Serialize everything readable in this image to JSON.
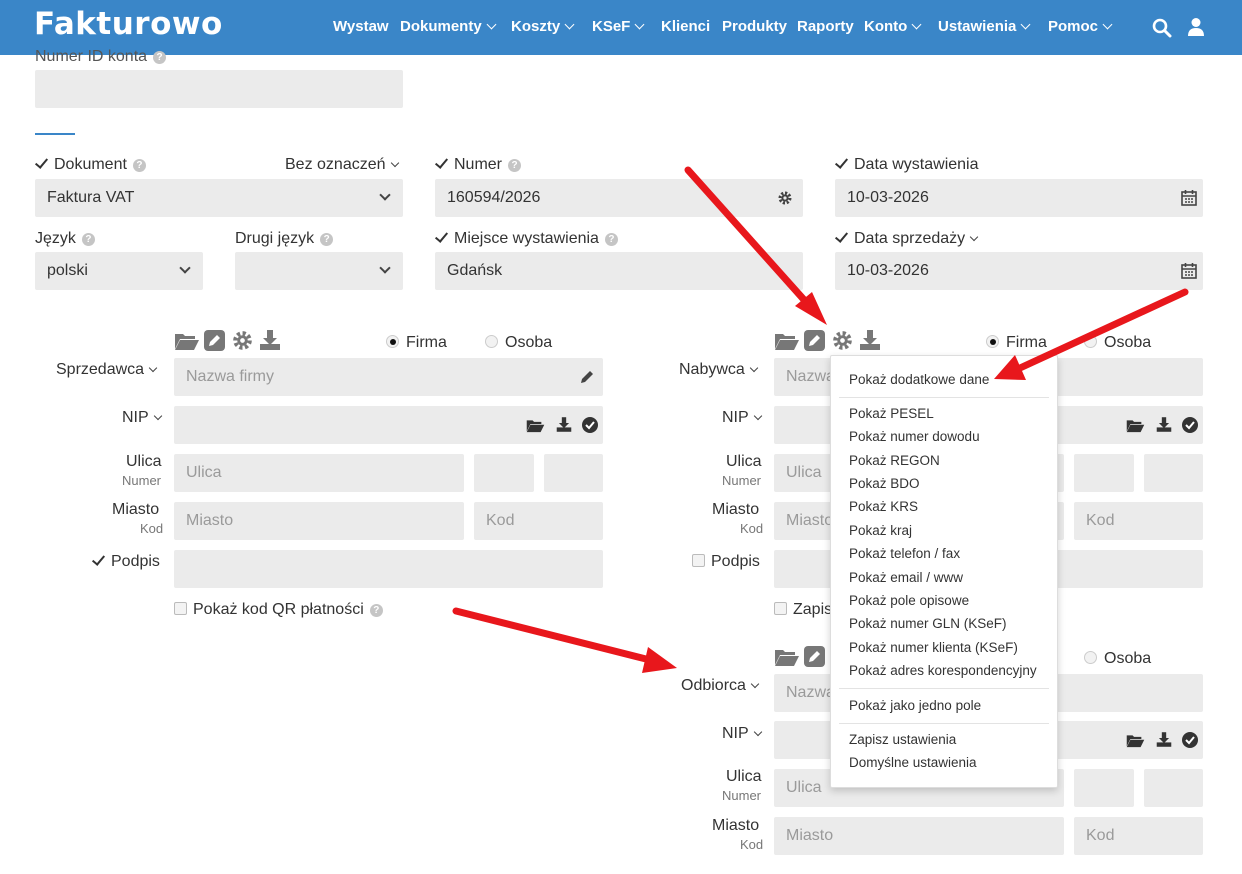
{
  "app": {
    "logo": "Fakturowo",
    "nav": [
      {
        "label": "Wystaw",
        "dropdown": false
      },
      {
        "label": "Dokumenty",
        "dropdown": true
      },
      {
        "label": "Koszty",
        "dropdown": true
      },
      {
        "label": "KSeF",
        "dropdown": true
      },
      {
        "label": "Klienci",
        "dropdown": false
      },
      {
        "label": "Produkty",
        "dropdown": false
      },
      {
        "label": "Raporty",
        "dropdown": false
      },
      {
        "label": "Konto",
        "dropdown": true
      },
      {
        "label": "Ustawienia",
        "dropdown": true
      },
      {
        "label": "Pomoc",
        "dropdown": true
      }
    ],
    "colors": {
      "navbar": "#3a86c8",
      "field_bg": "#ebebeb",
      "accent_line": "#3a86c8",
      "arrow": "#e8171c"
    }
  },
  "account": {
    "label": "Numer ID konta",
    "value": ""
  },
  "document": {
    "label": "Dokument",
    "marking": "Bez oznaczeń",
    "value": "Faktura VAT"
  },
  "number": {
    "label": "Numer",
    "value": "160594/2026"
  },
  "issue_date": {
    "label": "Data wystawienia",
    "value": "10-03-2026"
  },
  "language": {
    "label": "Język",
    "value": "polski"
  },
  "second_language": {
    "label": "Drugi język",
    "value": ""
  },
  "place": {
    "label": "Miejsce wystawienia",
    "value": "Gdańsk"
  },
  "sale_date": {
    "label": "Data sprzedaży",
    "value": "10-03-2026"
  },
  "seller": {
    "label": "Sprzedawca",
    "type_company": "Firma",
    "type_person": "Osoba",
    "name_placeholder": "Nazwa firmy",
    "nip_label": "NIP",
    "street_label": "Ulica",
    "street_sub": "Numer",
    "street_placeholder": "Ulica",
    "city_label": "Miasto",
    "city_sub": "Kod",
    "city_placeholder": "Miasto",
    "code_placeholder": "Kod",
    "signature_label": "Podpis",
    "qr_label": "Pokaż kod QR płatności"
  },
  "buyer": {
    "label": "Nabywca",
    "type_company": "Firma",
    "type_person": "Osoba",
    "name_placeholder": "Nazwa",
    "nip_label": "NIP",
    "street_label": "Ulica",
    "street_sub": "Numer",
    "street_placeholder": "Ulica",
    "city_label": "Miasto",
    "city_sub": "Kod",
    "city_placeholder": "Miasto",
    "code_placeholder": "Kod",
    "signature_label": "Podpis",
    "save_label": "Zapis"
  },
  "recipient": {
    "label": "Odbiorca",
    "type_person": "Osoba",
    "name_placeholder": "Nazwa",
    "nip_label": "NIP",
    "street_label": "Ulica",
    "street_sub": "Numer",
    "street_placeholder": "Ulica",
    "city_label": "Miasto",
    "city_sub": "Kod",
    "city_placeholder": "Miasto",
    "code_placeholder": "Kod"
  },
  "menu": {
    "top": "Pokaż dodatkowe dane",
    "items": [
      "Pokaż PESEL",
      "Pokaż numer dowodu",
      "Pokaż REGON",
      "Pokaż BDO",
      "Pokaż KRS",
      "Pokaż kraj",
      "Pokaż telefon / fax",
      "Pokaż email / www",
      "Pokaż pole opisowe",
      "Pokaż numer GLN (KSeF)",
      "Pokaż numer klienta (KSeF)",
      "Pokaż adres korespondencyjny"
    ],
    "single_field": "Pokaż jako jedno pole",
    "save": "Zapisz ustawienia",
    "defaults": "Domyślne ustawienia"
  }
}
